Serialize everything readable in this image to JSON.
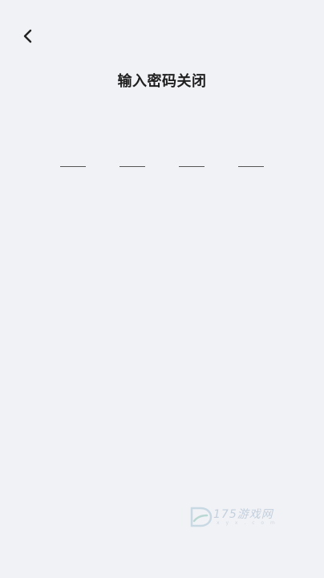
{
  "header": {
    "back_icon": "chevron-left-icon",
    "title": "输入密码关闭"
  },
  "pin": {
    "slots": [
      "",
      "",
      "",
      ""
    ]
  },
  "watermark": {
    "logo_icon": "d-logo-icon",
    "text": "175游戏网",
    "sub": "x y x . c o m"
  }
}
